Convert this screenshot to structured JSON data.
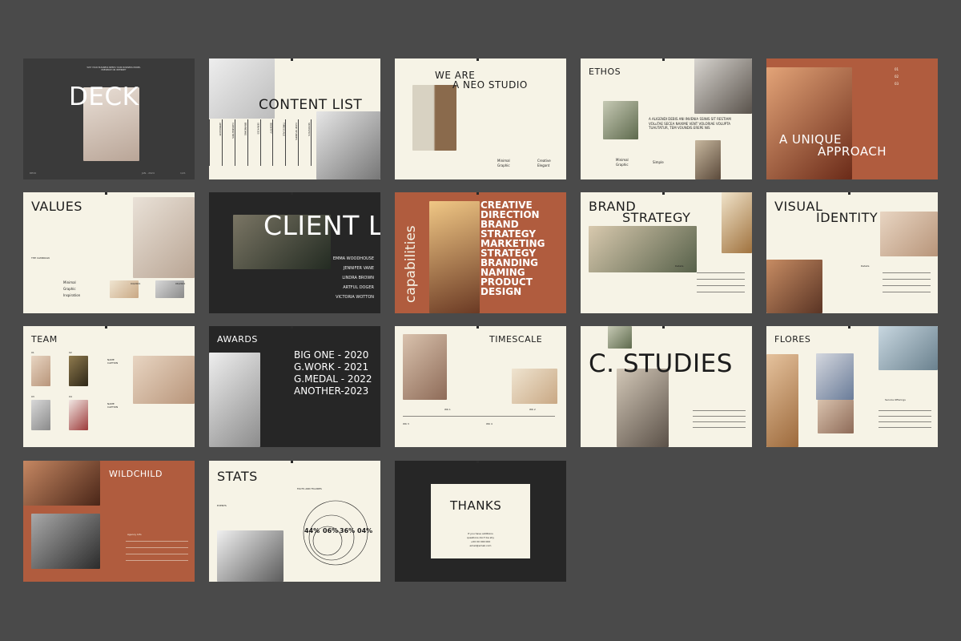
{
  "slides": {
    "deck": {
      "title": "DECK",
      "subtitle": "WHY YOUR BUSINESS NEEDS YOUR BUSINESS MODEL PRESENCE ON INTERNET",
      "footer_left": "DECK",
      "footer_mid": "JAN - 2024",
      "footer_right": "1/21"
    },
    "content_list": {
      "title": "CONTENT LIST",
      "items": [
        "APPROACH",
        "CAPABILITIES",
        "BRANDING",
        "SERVICES",
        "IDENTITY",
        "TIMESCALE",
        "CASE STUDIES",
        "STATISTICS"
      ]
    },
    "neo_studio": {
      "title_line1": "WE ARE",
      "title_line2": "A NEO STUDIO",
      "rows": [
        "Minimal",
        "Graphic",
        "Creative",
        "Elegant"
      ]
    },
    "ethos": {
      "title": "ETHOS",
      "quote": "A ALIGENDI DEBIS ANI INVENIA SSINIS SIT RESTIAM VOLuTAE SECEA NAXIME VENT VOLORIAE VOLUPTA TUAUTATUR, TEM VOUNDIS EREPE NIS",
      "rows": [
        "Minimal",
        "Graphic",
        "Simple"
      ]
    },
    "approach": {
      "title_line1": "A UNIQUE",
      "title_line2": "APPROACH",
      "rows": [
        "01",
        "02",
        "03"
      ]
    },
    "values": {
      "title": "VALUES",
      "label": "THE CAMPAIGN",
      "rows": [
        "Minimal",
        "Graphic",
        "Inspiration"
      ],
      "caption1": "04/2021",
      "caption2": "06/2021"
    },
    "client_list": {
      "title": "CLIENT L",
      "names": [
        "EMMA WOODHOUSE",
        "JENNIFER VANE",
        "LINDRA BROWN",
        "ARTFUL DOGER",
        "VICTORIA WOTTON"
      ]
    },
    "capabilities": {
      "title": "capabilities",
      "items": [
        "CREATIVE",
        "DIRECTION",
        "BRAND",
        "STRATEGY",
        "MARKETING",
        "STRATEGY",
        "BRANDING",
        "NAMING",
        "PRODUCT",
        "DESIGN"
      ]
    },
    "brand_strategy": {
      "title_line1": "BRAND",
      "title_line2": "STRATEGY",
      "label": "Details"
    },
    "visual_identity": {
      "title_line1": "VISUAL",
      "title_line2": "IDENTITY",
      "label": "Details"
    },
    "team": {
      "title": "TEAM",
      "numbers": [
        "01",
        "02",
        "03",
        "04"
      ],
      "caption": "NAME CAPTION"
    },
    "awards": {
      "title": "AWARDS",
      "items": [
        "BIG ONE - 2020",
        "G.WORK - 2021",
        "G.MEDAL - 2022",
        "ANOTHER-2023"
      ]
    },
    "timescale": {
      "title": "TIMESCALE",
      "labels": [
        "WK 1",
        "WK 2",
        "WK 3",
        "WK 4"
      ]
    },
    "studies": {
      "title": "C. STUDIES"
    },
    "flores": {
      "title": "FLORES",
      "label": "Service Offerings"
    },
    "wildchild": {
      "title": "WILDCHILD",
      "label": "Agency Info"
    },
    "stats": {
      "title": "STATS",
      "heading": "FACTS AND FIGURES",
      "label": "EVENTS",
      "values": [
        "44%",
        "06%",
        "36%",
        "04%"
      ]
    },
    "thanks": {
      "title": "THANKS",
      "line1": "If you have additions",
      "line2": "questions don't be shy",
      "phone": "+00 00 000 000",
      "email": "email@email.com"
    }
  }
}
